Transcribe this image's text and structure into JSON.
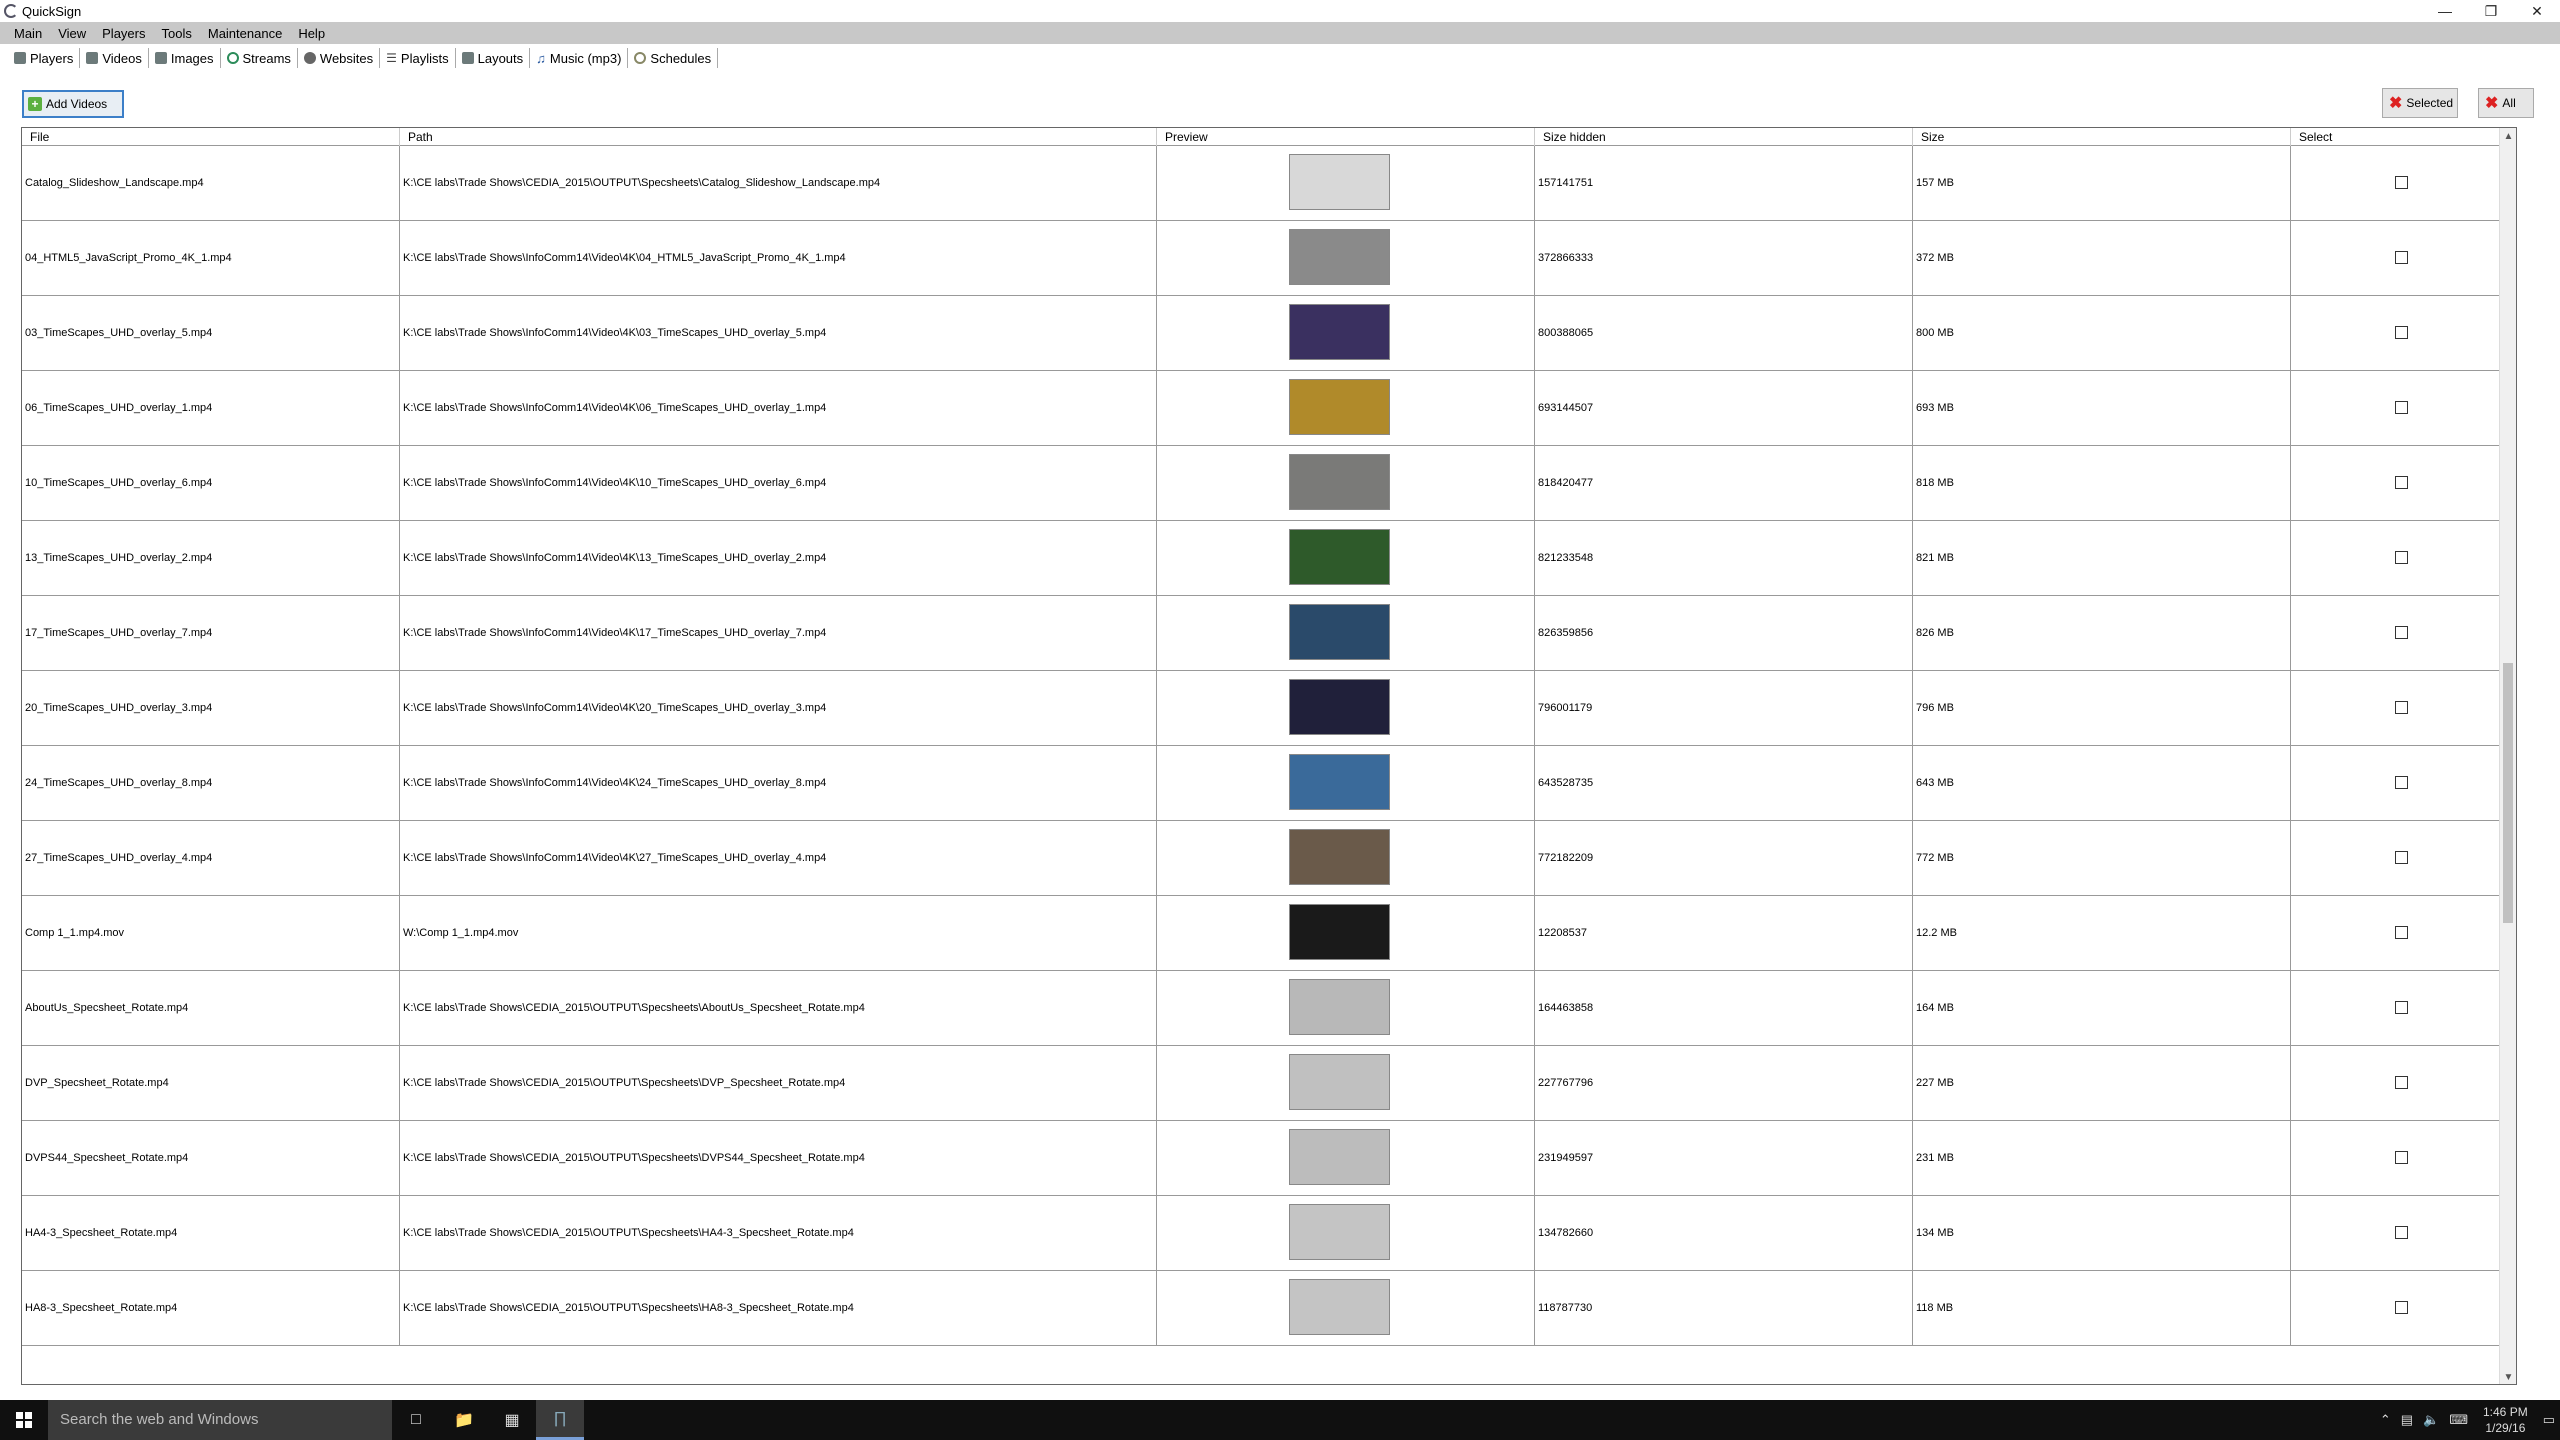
{
  "window": {
    "title": "QuickSign"
  },
  "menu": [
    "Main",
    "View",
    "Players",
    "Tools",
    "Maintenance",
    "Help"
  ],
  "toolbar": [
    {
      "label": "Players",
      "icon": "players-icon"
    },
    {
      "label": "Videos",
      "icon": "videos-icon"
    },
    {
      "label": "Images",
      "icon": "images-icon"
    },
    {
      "label": "Streams",
      "icon": "streams-icon"
    },
    {
      "label": "Websites",
      "icon": "websites-icon"
    },
    {
      "label": "Playlists",
      "icon": "playlists-icon"
    },
    {
      "label": "Layouts",
      "icon": "layouts-icon"
    },
    {
      "label": "Music (mp3)",
      "icon": "music-icon"
    },
    {
      "label": "Schedules",
      "icon": "schedules-icon"
    }
  ],
  "actions": {
    "add": "Add Videos",
    "delete_selected": "Selected",
    "delete_all": "All"
  },
  "columns": [
    "File",
    "Path",
    "Preview",
    "Size hidden",
    "Size",
    "Select"
  ],
  "rows": [
    {
      "file": "Catalog_Slideshow_Landscape.mp4",
      "path": "K:\\CE labs\\Trade Shows\\CEDIA_2015\\OUTPUT\\Specsheets\\Catalog_Slideshow_Landscape.mp4",
      "size_hidden": "157141751",
      "size": "157 MB",
      "preview_color": "#d8d8d8"
    },
    {
      "file": "04_HTML5_JavaScript_Promo_4K_1.mp4",
      "path": "K:\\CE labs\\Trade Shows\\InfoComm14\\Video\\4K\\04_HTML5_JavaScript_Promo_4K_1.mp4",
      "size_hidden": "372866333",
      "size": "372 MB",
      "preview_color": "#8a8a8a"
    },
    {
      "file": "03_TimeScapes_UHD_overlay_5.mp4",
      "path": "K:\\CE labs\\Trade Shows\\InfoComm14\\Video\\4K\\03_TimeScapes_UHD_overlay_5.mp4",
      "size_hidden": "800388065",
      "size": "800 MB",
      "preview_color": "#3a3060"
    },
    {
      "file": "06_TimeScapes_UHD_overlay_1.mp4",
      "path": "K:\\CE labs\\Trade Shows\\InfoComm14\\Video\\4K\\06_TimeScapes_UHD_overlay_1.mp4",
      "size_hidden": "693144507",
      "size": "693 MB",
      "preview_color": "#b08a2a"
    },
    {
      "file": "10_TimeScapes_UHD_overlay_6.mp4",
      "path": "K:\\CE labs\\Trade Shows\\InfoComm14\\Video\\4K\\10_TimeScapes_UHD_overlay_6.mp4",
      "size_hidden": "818420477",
      "size": "818 MB",
      "preview_color": "#7a7a78"
    },
    {
      "file": "13_TimeScapes_UHD_overlay_2.mp4",
      "path": "K:\\CE labs\\Trade Shows\\InfoComm14\\Video\\4K\\13_TimeScapes_UHD_overlay_2.mp4",
      "size_hidden": "821233548",
      "size": "821 MB",
      "preview_color": "#2e5a2a"
    },
    {
      "file": "17_TimeScapes_UHD_overlay_7.mp4",
      "path": "K:\\CE labs\\Trade Shows\\InfoComm14\\Video\\4K\\17_TimeScapes_UHD_overlay_7.mp4",
      "size_hidden": "826359856",
      "size": "826 MB",
      "preview_color": "#2a4a6a"
    },
    {
      "file": "20_TimeScapes_UHD_overlay_3.mp4",
      "path": "K:\\CE labs\\Trade Shows\\InfoComm14\\Video\\4K\\20_TimeScapes_UHD_overlay_3.mp4",
      "size_hidden": "796001179",
      "size": "796 MB",
      "preview_color": "#20203a"
    },
    {
      "file": "24_TimeScapes_UHD_overlay_8.mp4",
      "path": "K:\\CE labs\\Trade Shows\\InfoComm14\\Video\\4K\\24_TimeScapes_UHD_overlay_8.mp4",
      "size_hidden": "643528735",
      "size": "643 MB",
      "preview_color": "#3a6a9a"
    },
    {
      "file": "27_TimeScapes_UHD_overlay_4.mp4",
      "path": "K:\\CE labs\\Trade Shows\\InfoComm14\\Video\\4K\\27_TimeScapes_UHD_overlay_4.mp4",
      "size_hidden": "772182209",
      "size": "772 MB",
      "preview_color": "#6a5a4a"
    },
    {
      "file": "Comp 1_1.mp4.mov",
      "path": "W:\\Comp 1_1.mp4.mov",
      "size_hidden": "12208537",
      "size": "12.2 MB",
      "preview_color": "#1a1a1a"
    },
    {
      "file": "AboutUs_Specsheet_Rotate.mp4",
      "path": "K:\\CE labs\\Trade Shows\\CEDIA_2015\\OUTPUT\\Specsheets\\AboutUs_Specsheet_Rotate.mp4",
      "size_hidden": "164463858",
      "size": "164 MB",
      "preview_color": "#b8b8b8"
    },
    {
      "file": "DVP_Specsheet_Rotate.mp4",
      "path": "K:\\CE labs\\Trade Shows\\CEDIA_2015\\OUTPUT\\Specsheets\\DVP_Specsheet_Rotate.mp4",
      "size_hidden": "227767796",
      "size": "227 MB",
      "preview_color": "#c0c0c0"
    },
    {
      "file": "DVPS44_Specsheet_Rotate.mp4",
      "path": "K:\\CE labs\\Trade Shows\\CEDIA_2015\\OUTPUT\\Specsheets\\DVPS44_Specsheet_Rotate.mp4",
      "size_hidden": "231949597",
      "size": "231 MB",
      "preview_color": "#bcbcbc"
    },
    {
      "file": "HA4-3_Specsheet_Rotate.mp4",
      "path": "K:\\CE labs\\Trade Shows\\CEDIA_2015\\OUTPUT\\Specsheets\\HA4-3_Specsheet_Rotate.mp4",
      "size_hidden": "134782660",
      "size": "134 MB",
      "preview_color": "#c4c4c4"
    },
    {
      "file": "HA8-3_Specsheet_Rotate.mp4",
      "path": "K:\\CE labs\\Trade Shows\\CEDIA_2015\\OUTPUT\\Specsheets\\HA8-3_Specsheet_Rotate.mp4",
      "size_hidden": "118787730",
      "size": "118 MB",
      "preview_color": "#c4c4c4"
    }
  ],
  "taskbar": {
    "search_placeholder": "Search the web and Windows",
    "time": "1:46 PM",
    "date": "1/29/16"
  }
}
